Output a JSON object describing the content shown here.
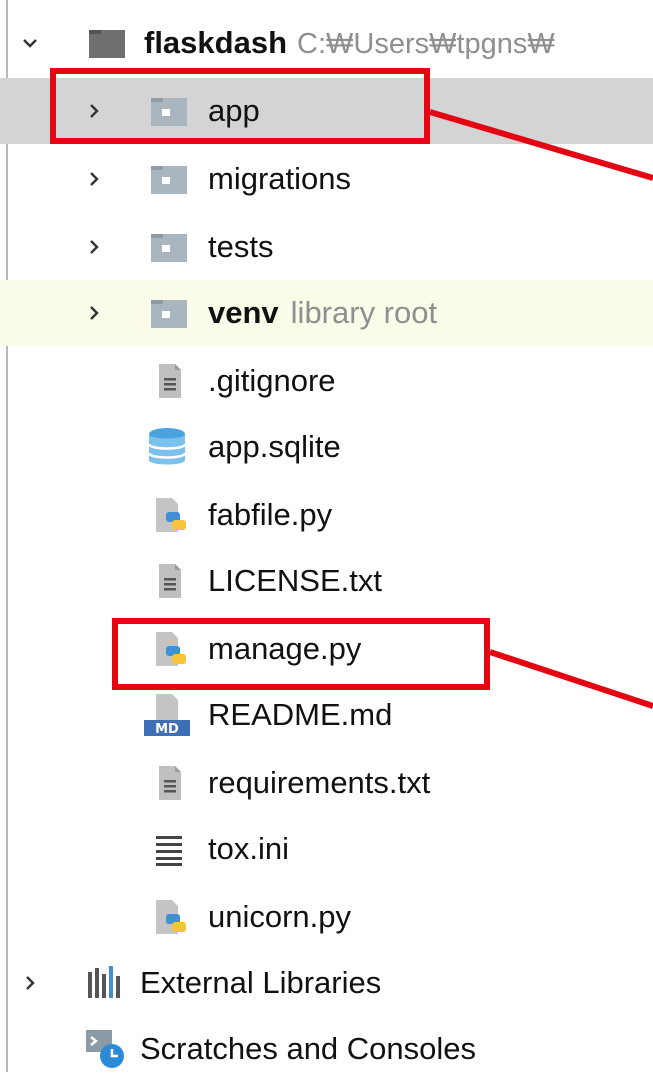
{
  "tree": {
    "root": {
      "name": "flaskdash",
      "path": "C:₩Users₩tpgns₩"
    },
    "items": [
      {
        "label": "app",
        "kind": "folder",
        "expandable": true
      },
      {
        "label": "migrations",
        "kind": "folder",
        "expandable": true
      },
      {
        "label": "tests",
        "kind": "folder",
        "expandable": true
      },
      {
        "label": "venv",
        "hint": "library root",
        "kind": "folder",
        "expandable": true
      },
      {
        "label": ".gitignore",
        "kind": "text-file"
      },
      {
        "label": "app.sqlite",
        "kind": "database-file"
      },
      {
        "label": "fabfile.py",
        "kind": "python-file"
      },
      {
        "label": "LICENSE.txt",
        "kind": "text-file"
      },
      {
        "label": "manage.py",
        "kind": "python-file"
      },
      {
        "label": "README.md",
        "kind": "markdown-file",
        "badge": "MD"
      },
      {
        "label": "requirements.txt",
        "kind": "text-file"
      },
      {
        "label": "tox.ini",
        "kind": "ini-file"
      },
      {
        "label": "unicorn.py",
        "kind": "python-file"
      }
    ],
    "external_libraries": "External Libraries",
    "scratches": "Scratches and Consoles"
  },
  "colors": {
    "highlight": "#e30613",
    "selected_row": "#d4d4d4",
    "library_row": "#fbfbe9",
    "folder": "#a9b6bf",
    "python_blue": "#3f8fd6",
    "python_yellow": "#f5c43a"
  }
}
